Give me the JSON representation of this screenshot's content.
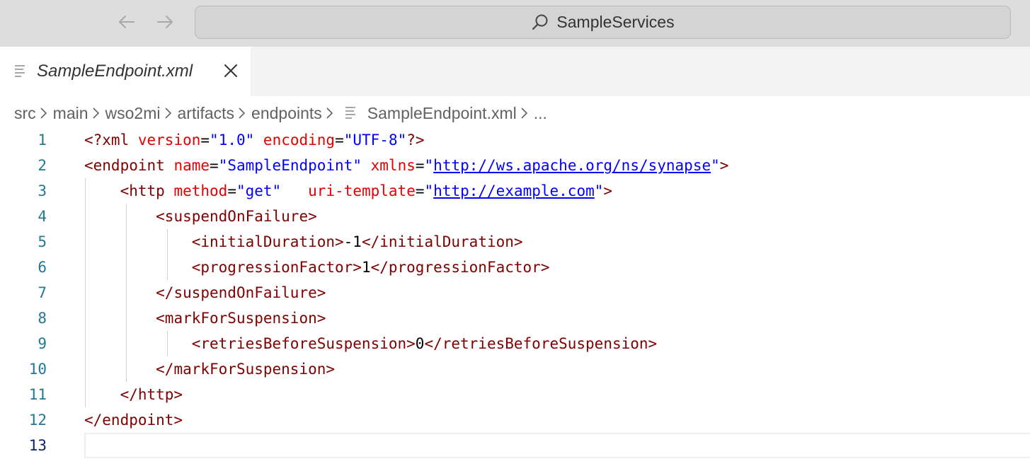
{
  "titlebar": {
    "back_icon": "arrow-left-icon",
    "forward_icon": "arrow-right-icon",
    "search_text": "SampleServices"
  },
  "tab": {
    "label": "SampleEndpoint.xml",
    "icon": "file-lines-icon",
    "close_icon": "close-icon"
  },
  "breadcrumb": {
    "items": [
      "src",
      "main",
      "wso2mi",
      "artifacts",
      "endpoints",
      "SampleEndpoint.xml",
      "..."
    ]
  },
  "editor": {
    "active_line": 13,
    "lines": [
      {
        "num": "1"
      },
      {
        "num": "2"
      },
      {
        "num": "3"
      },
      {
        "num": "4"
      },
      {
        "num": "5"
      },
      {
        "num": "6"
      },
      {
        "num": "7"
      },
      {
        "num": "8"
      },
      {
        "num": "9"
      },
      {
        "num": "10"
      },
      {
        "num": "11"
      },
      {
        "num": "12"
      },
      {
        "num": "13"
      }
    ],
    "tokens": {
      "l1": [
        "<?xml",
        "version",
        "=",
        "\"1.0\"",
        "encoding",
        "=",
        "\"UTF-8\"",
        "?>"
      ],
      "l2": [
        "<endpoint",
        "name",
        "=",
        "\"SampleEndpoint\"",
        "xmlns",
        "=",
        "\"",
        "http://ws.apache.org/ns/synapse",
        "\"",
        ">"
      ],
      "l3": [
        "<http",
        "method",
        "=",
        "\"get\"",
        "uri-template",
        "=",
        "\"",
        "http://example.com",
        "\"",
        ">"
      ],
      "l4": [
        "<suspendOnFailure>"
      ],
      "l5": [
        "<initialDuration>",
        "-1",
        "</initialDuration>"
      ],
      "l6": [
        "<progressionFactor>",
        "1",
        "</progressionFactor>"
      ],
      "l7": [
        "</suspendOnFailure>"
      ],
      "l8": [
        "<markForSuspension>"
      ],
      "l9": [
        "<retriesBeforeSuspension>",
        "0",
        "</retriesBeforeSuspension>"
      ],
      "l10": [
        "</markForSuspension>"
      ],
      "l11": [
        "</http>"
      ],
      "l12": [
        "</endpoint>"
      ]
    }
  },
  "colors": {
    "tag": "#800000",
    "attribute": "#e50000",
    "value": "#0000ff",
    "line_number": "#237893",
    "active_line_number": "#0b216f"
  }
}
